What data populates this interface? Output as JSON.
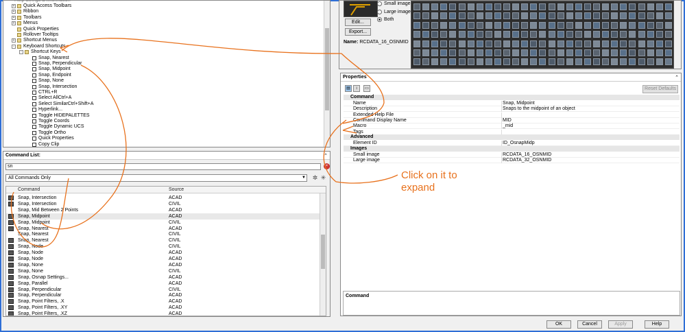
{
  "tree": {
    "items": [
      {
        "label": "Quick Access Toolbars",
        "level": 1,
        "exp": "+",
        "icon": "folder"
      },
      {
        "label": "Ribbon",
        "level": 1,
        "exp": "+",
        "icon": "folder"
      },
      {
        "label": "Toolbars",
        "level": 1,
        "exp": "+",
        "icon": "folder"
      },
      {
        "label": "Menus",
        "level": 1,
        "exp": "+",
        "icon": "folder"
      },
      {
        "label": "Quick Properties",
        "level": 1,
        "exp": "",
        "icon": "folder"
      },
      {
        "label": "Rollover Tooltips",
        "level": 1,
        "exp": "",
        "icon": "folder"
      },
      {
        "label": "Shortcut Menus",
        "level": 1,
        "exp": "+",
        "icon": "folder"
      },
      {
        "label": "Keyboard Shortcuts",
        "level": 1,
        "exp": "-",
        "icon": "folder"
      },
      {
        "label": "Shortcut Keys",
        "level": 2,
        "exp": "-",
        "icon": "folder"
      },
      {
        "label": "Snap, Nearest",
        "level": 3,
        "exp": "",
        "icon": "key"
      },
      {
        "label": "Snap, Perpendicular",
        "level": 3,
        "exp": "",
        "icon": "key"
      },
      {
        "label": "Snap, Midpoint",
        "level": 3,
        "exp": "",
        "icon": "key"
      },
      {
        "label": "Snap, Endpoint",
        "level": 3,
        "exp": "",
        "icon": "key"
      },
      {
        "label": "Snap, None",
        "level": 3,
        "exp": "",
        "icon": "key"
      },
      {
        "label": "Snap, Intersection",
        "level": 3,
        "exp": "",
        "icon": "key"
      },
      {
        "label": "CTRL+R",
        "level": 3,
        "exp": "",
        "icon": "key"
      },
      {
        "label": "Select AllCtrl+A",
        "level": 3,
        "exp": "",
        "icon": "key"
      },
      {
        "label": "Select SimilarCtrl+Shift+A",
        "level": 3,
        "exp": "",
        "icon": "key"
      },
      {
        "label": "Hyperlink...",
        "level": 3,
        "exp": "",
        "icon": "key"
      },
      {
        "label": "Toggle HIDEPALETTES",
        "level": 3,
        "exp": "",
        "icon": "key"
      },
      {
        "label": "Toggle Coords",
        "level": 3,
        "exp": "",
        "icon": "key"
      },
      {
        "label": "Toggle Dynamic UCS",
        "level": 3,
        "exp": "",
        "icon": "key"
      },
      {
        "label": "Toggle Ortho",
        "level": 3,
        "exp": "",
        "icon": "key"
      },
      {
        "label": "Quick Properties",
        "level": 3,
        "exp": "",
        "icon": "key"
      },
      {
        "label": "Copy Clip",
        "level": 3,
        "exp": "",
        "icon": "key"
      }
    ]
  },
  "command_list": {
    "title": "Command List:",
    "search_value": "sn",
    "filter_value": "All Commands Only",
    "headers": {
      "command": "Command",
      "source": "Source"
    },
    "rows": [
      {
        "name": "Snap, Intersection",
        "source": "ACAD",
        "icon": true
      },
      {
        "name": "Snap, Intersection",
        "source": "CIVIL",
        "icon": true
      },
      {
        "name": "Snap, Mid Between 2 Points",
        "source": "ACAD",
        "icon": false
      },
      {
        "name": "Snap, Midpoint",
        "source": "ACAD",
        "icon": true,
        "selected": true
      },
      {
        "name": "Snap, Midpoint",
        "source": "CIVIL",
        "icon": true
      },
      {
        "name": "Snap, Nearest",
        "source": "ACAD",
        "icon": true
      },
      {
        "name": "Snap, Nearest",
        "source": "CIVIL",
        "icon": false
      },
      {
        "name": "Snap, Nearest",
        "source": "CIVIL",
        "icon": true
      },
      {
        "name": "Snap, Node",
        "source": "CIVIL",
        "icon": true
      },
      {
        "name": "Snap, Node",
        "source": "ACAD",
        "icon": true
      },
      {
        "name": "Snap, Node",
        "source": "ACAD",
        "icon": true
      },
      {
        "name": "Snap, None",
        "source": "ACAD",
        "icon": true
      },
      {
        "name": "Snap, None",
        "source": "CIVIL",
        "icon": true
      },
      {
        "name": "Snap, Osnap Settings...",
        "source": "ACAD",
        "icon": true
      },
      {
        "name": "Snap, Parallel",
        "source": "ACAD",
        "icon": true
      },
      {
        "name": "Snap, Perpendicular",
        "source": "CIVIL",
        "icon": true
      },
      {
        "name": "Snap, Perpendicular",
        "source": "ACAD",
        "icon": true
      },
      {
        "name": "Snap, Point Filters, .X",
        "source": "ACAD",
        "icon": true
      },
      {
        "name": "Snap, Point Filters, .XY",
        "source": "ACAD",
        "icon": true
      },
      {
        "name": "Snap, Point Filters, .XZ",
        "source": "ACAD",
        "icon": true
      }
    ]
  },
  "image": {
    "small_label": "Small image",
    "large_label": "Large image",
    "both_label": "Both",
    "edit_label": "Edit...",
    "export_label": "Export...",
    "name_label": "Name:",
    "name_value": "RCDATA_16_OSNMID"
  },
  "properties": {
    "title": "Properties",
    "reset_label": "Reset Defaults",
    "categories": {
      "command": "Command",
      "advanced": "Advanced",
      "images": "Images"
    },
    "command_rows": [
      {
        "key": "Name",
        "value": "Snap, Midpoint"
      },
      {
        "key": "Description",
        "value": "Snaps to the midpoint of an object"
      },
      {
        "key": "Extended Help File",
        "value": ""
      },
      {
        "key": "Command Display Name",
        "value": "MID"
      },
      {
        "key": "Macro",
        "value": "_mid"
      },
      {
        "key": "Tags",
        "value": ""
      }
    ],
    "advanced_rows": [
      {
        "key": "Element ID",
        "value": "ID_OsnapMidp"
      }
    ],
    "image_rows": [
      {
        "key": "Small image",
        "value": "RCDATA_16_OSNMID"
      },
      {
        "key": "Large image",
        "value": "RCDATA_32_OSNMID"
      }
    ],
    "command_box_title": "Command"
  },
  "annotation": {
    "line1": "Click on it to",
    "line2": "expand"
  },
  "dialog_buttons": {
    "ok": "OK",
    "cancel": "Cancel",
    "apply": "Apply",
    "help": "Help"
  },
  "colors": {
    "annotation": "#e8711c",
    "frame": "#2f6fd6"
  }
}
